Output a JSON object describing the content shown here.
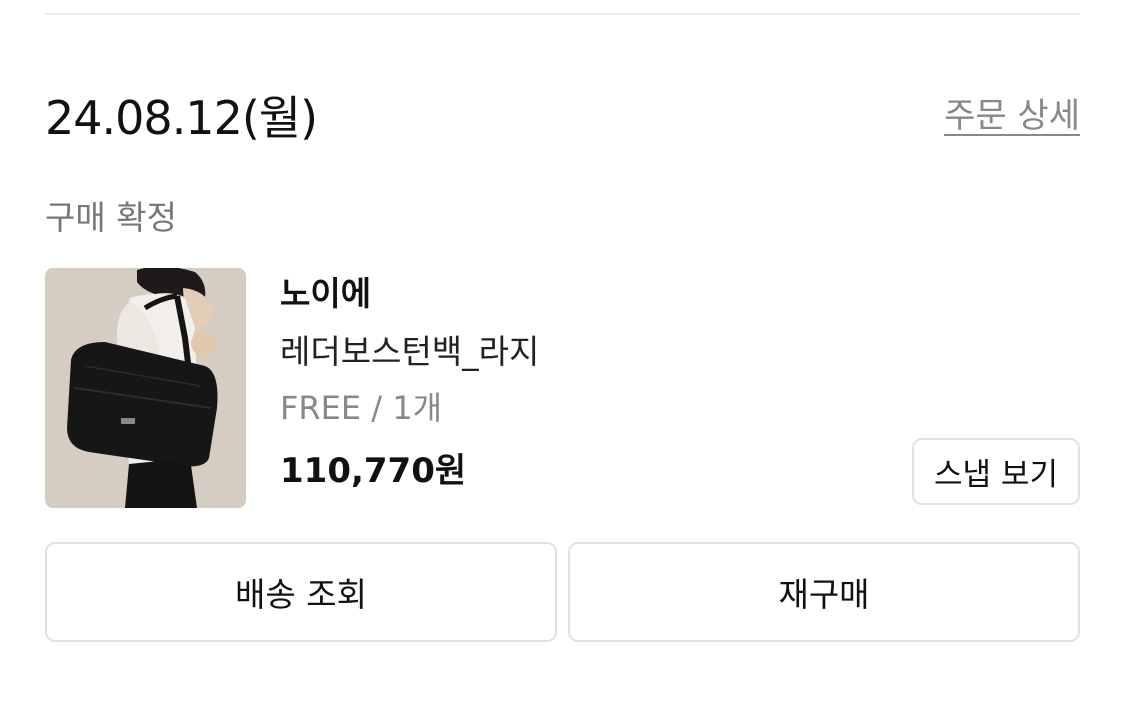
{
  "order": {
    "date": "24.08.12(월)",
    "detail_link": "주문 상세",
    "status": "구매 확정"
  },
  "product": {
    "image_icon": "product-photo-leather-boston-bag",
    "brand": "노이에",
    "name": "레더보스턴백_라지",
    "option": "FREE / 1개",
    "price": "110,770원"
  },
  "buttons": {
    "snap": "스냅 보기",
    "track_delivery": "배송 조회",
    "rebuy": "재구매"
  },
  "colors": {
    "divider": "#eeeeee",
    "muted_text": "#888888",
    "button_border": "#e1e1e1"
  }
}
